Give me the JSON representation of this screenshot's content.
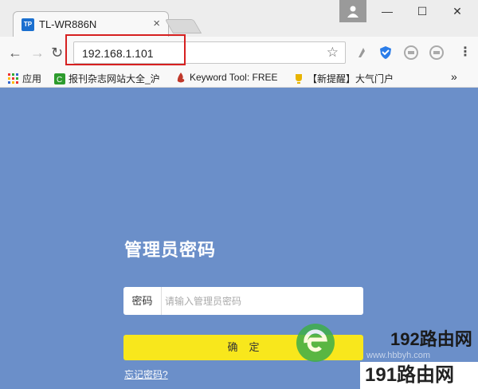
{
  "browser": {
    "tab_title": "TL-WR886N",
    "tab_favicon": "TP",
    "tab_close": "×",
    "window_min": "—",
    "window_max": "☐",
    "window_close": "✕",
    "url": "192.168.1.101",
    "icons": [
      "back-icon",
      "forward-icon",
      "reload-icon",
      "star-icon",
      "profile-icon",
      "menu-icon"
    ]
  },
  "bookmarks": [
    {
      "label": "应用",
      "icon": "apps-icon"
    },
    {
      "label": "报刊杂志网站大全_沪",
      "icon": "bookmark-green-icon"
    },
    {
      "label": "Keyword Tool: FREE",
      "icon": "bookmark-flame-icon"
    },
    {
      "label": "【新提醒】大气门户",
      "icon": "bookmark-trophy-icon"
    }
  ],
  "bookmarks_more": "»",
  "login": {
    "title": "管理员密码",
    "password_label": "密码",
    "password_placeholder": "请输入管理员密码",
    "confirm_button": "确定",
    "forgot_link": "忘记密码?"
  },
  "watermark": {
    "brand_192": "192路由网",
    "url": "www.hbbyh.com",
    "brand_191": "191路由网"
  },
  "colors": {
    "page_background": "#6b8fc9",
    "confirm_button": "#f8e71c",
    "highlight_box": "#d62020"
  }
}
